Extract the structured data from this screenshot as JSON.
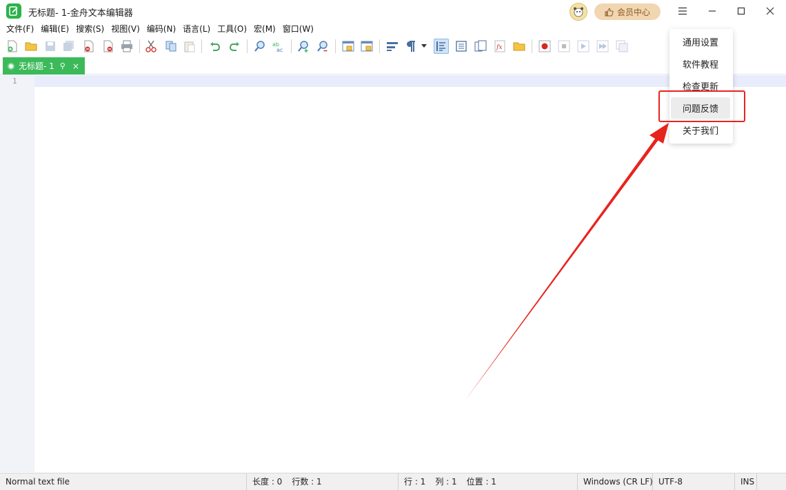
{
  "window": {
    "title": "无标题- 1-金舟文本编辑器",
    "vip_label": "会员中心"
  },
  "menus": [
    "文件(F)",
    "编辑(E)",
    "搜索(S)",
    "视图(V)",
    "编码(N)",
    "语言(L)",
    "工具(O)",
    "宏(M)",
    "窗口(W)"
  ],
  "tab": {
    "label": "无标题- 1",
    "pin_glyph": "⚲",
    "close_glyph": "×"
  },
  "editor": {
    "line_number": "1"
  },
  "dropdown": {
    "items": [
      "通用设置",
      "软件教程",
      "检查更新",
      "问题反馈",
      "关于我们"
    ],
    "highlighted_index": 3
  },
  "status": {
    "file_type": "Normal text file",
    "length": "长度 : 0",
    "lines": "行数 : 1",
    "row": "行 : 1",
    "col": "列 : 1",
    "pos": "位置 : 1",
    "eol": "Windows (CR LF)",
    "encoding": "UTF-8",
    "mode": "INS"
  },
  "colors": {
    "accent_green": "#3cba5a",
    "annotation_red": "#e8231e",
    "vip_bg": "#f1d6b2"
  }
}
